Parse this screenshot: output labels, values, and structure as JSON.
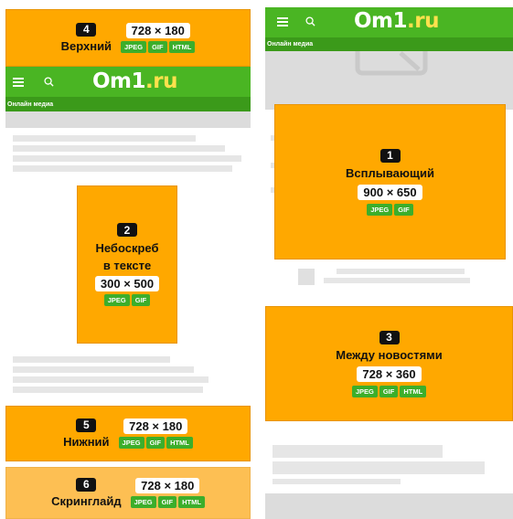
{
  "site": {
    "logo_main": "Om1",
    "logo_suffix": ".ru",
    "tagline": "Онлайн медиа"
  },
  "ads": [
    {
      "number": "1",
      "title": "Всплывающий",
      "size": "900 × 650",
      "formats": [
        "JPEG",
        "GIF"
      ]
    },
    {
      "number": "2",
      "title_line1": "Небоскреб",
      "title_line2": "в тексте",
      "size": "300 × 500",
      "formats": [
        "JPEG",
        "GIF"
      ]
    },
    {
      "number": "3",
      "title": "Между новостями",
      "size": "728 × 360",
      "formats": [
        "JPEG",
        "GIF",
        "HTML"
      ]
    },
    {
      "number": "4",
      "title": "Верхний",
      "size": "728 × 180",
      "formats": [
        "JPEG",
        "GIF",
        "HTML"
      ]
    },
    {
      "number": "5",
      "title": "Нижний",
      "size": "728 × 180",
      "formats": [
        "JPEG",
        "GIF",
        "HTML"
      ]
    },
    {
      "number": "6",
      "title": "Скринглайд",
      "size": "728 × 180",
      "formats": [
        "JPEG",
        "GIF",
        "HTML"
      ]
    }
  ],
  "colors": {
    "brand_green": "#4ab523",
    "dark_green": "#3b9a1a",
    "ad_orange": "#ffa800",
    "format_green": "#3cae2b",
    "logo_accent": "#ffe14d"
  },
  "icons": [
    "menu-icon",
    "search-icon",
    "image-placeholder-icon"
  ]
}
